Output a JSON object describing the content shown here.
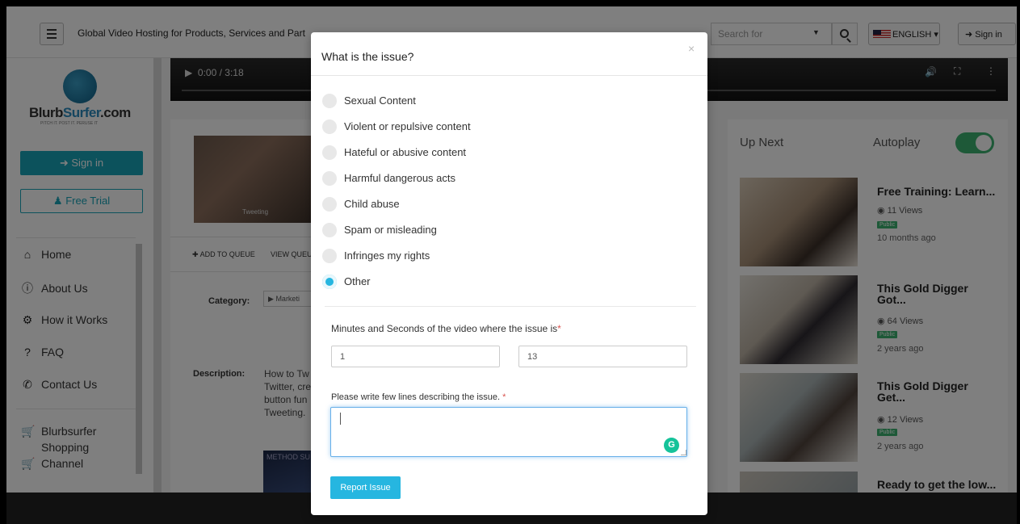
{
  "header": {
    "site_title": "Global Video Hosting for Products, Services and Part",
    "search_placeholder": "Search for",
    "language_label": "ENGLISH",
    "signin_label": "Sign in"
  },
  "sidebar": {
    "logo_text_main": "Blurb",
    "logo_text_accent": "Surfer",
    "logo_text_suffix": ".com",
    "logo_tagline": "PITCH IT. POST IT. PERUSE IT",
    "signin_label": "Sign in",
    "trial_label": "Free Trial",
    "items": [
      {
        "label": "Home",
        "icon": "home-icon"
      },
      {
        "label": "About Us",
        "icon": "info-icon"
      },
      {
        "label": "How it Works",
        "icon": "gears-icon"
      },
      {
        "label": "FAQ",
        "icon": "question-icon"
      },
      {
        "label": "Contact Us",
        "icon": "phone-icon"
      },
      {
        "label": "Blurbsurfer",
        "icon": "cart-icon"
      },
      {
        "label": "Shopping"
      },
      {
        "label": "Channel",
        "icon": "cart-icon"
      }
    ]
  },
  "player": {
    "time": "0:00 / 3:18"
  },
  "video": {
    "thumb_caption": "Tweeting",
    "add_to_queue": "ADD TO QUEUE",
    "view_queue": "VIEW QUEU",
    "category_label": "Category:",
    "category_value": "Marketi",
    "description_label": "Description:",
    "description_lines": [
      "How to Tw",
      "Twitter, cre",
      "button fun",
      "Tweeting."
    ],
    "mini_thumb_text": "METHOD SU connect"
  },
  "up_next": {
    "title": "Up Next",
    "autoplay_label": "Autoplay",
    "autoplay_on": true,
    "videos": [
      {
        "title": "Free Training: Learn...",
        "views": "11 Views",
        "badge": "Public",
        "time": "10 months ago"
      },
      {
        "title": "This Gold Digger Got...",
        "views": "64 Views",
        "badge": "Public",
        "time": "2 years ago"
      },
      {
        "title": "This Gold Digger Get...",
        "views": "12 Views",
        "badge": "Public",
        "time": "2 years ago"
      },
      {
        "title": "Ready to get the low...",
        "views": "",
        "badge": "",
        "time": ""
      }
    ]
  },
  "modal": {
    "title": "What is the issue?",
    "close": "×",
    "options": [
      {
        "label": "Sexual Content",
        "selected": false
      },
      {
        "label": "Violent or repulsive content",
        "selected": false
      },
      {
        "label": "Hateful or abusive content",
        "selected": false
      },
      {
        "label": "Harmful dangerous acts",
        "selected": false
      },
      {
        "label": "Child abuse",
        "selected": false
      },
      {
        "label": "Spam or misleading",
        "selected": false
      },
      {
        "label": "Infringes my rights",
        "selected": false
      },
      {
        "label": "Other",
        "selected": true
      }
    ],
    "time_question": "Minutes and Seconds of the video where the issue is",
    "required_mark": "*",
    "minutes_value": "1",
    "seconds_value": "13",
    "description_question": "Please write few lines describing the issue.",
    "description_value": "",
    "submit_label": "Report Issue"
  },
  "colors": {
    "accent": "#26b6e0",
    "sidebar_button": "#18a4b8",
    "toggle_on": "#3cb371",
    "required": "#d9534f"
  }
}
